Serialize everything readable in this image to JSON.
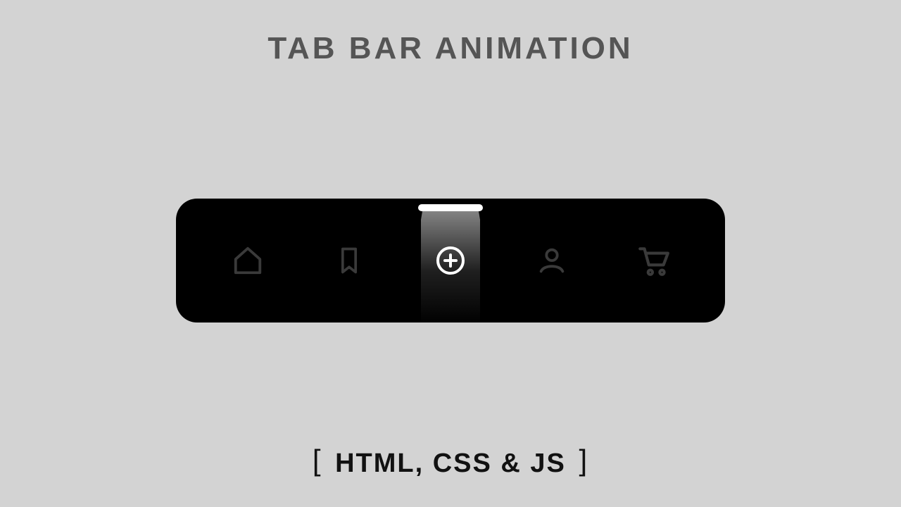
{
  "title": "TAB BAR  ANIMATION",
  "subtitle": {
    "open_bracket": "[",
    "text": " HTML, CSS & JS ",
    "close_bracket": "]"
  },
  "tabbar": {
    "active_index": 2,
    "items": [
      {
        "name": "home",
        "icon": "home-icon"
      },
      {
        "name": "bookmark",
        "icon": "bookmark-icon"
      },
      {
        "name": "add",
        "icon": "plus-circle-icon"
      },
      {
        "name": "profile",
        "icon": "user-icon"
      },
      {
        "name": "cart",
        "icon": "cart-icon"
      }
    ]
  },
  "colors": {
    "background": "#d3d3d3",
    "title_text": "#555555",
    "subtitle_text": "#111111",
    "tabbar_bg": "#000000",
    "icon_inactive": "#3a3a3a",
    "icon_active": "#ffffff",
    "spotlight": "#ffffff"
  }
}
